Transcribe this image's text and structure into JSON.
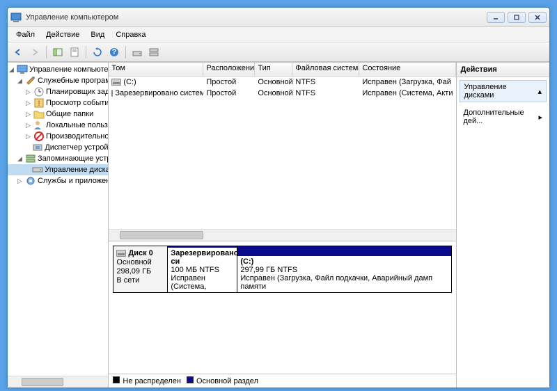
{
  "window": {
    "title": "Управление компьютером"
  },
  "menu": {
    "file": "Файл",
    "action": "Действие",
    "view": "Вид",
    "help": "Справка"
  },
  "tree": {
    "root": "Управление компьютером (л",
    "sys_tools": "Служебные программы",
    "scheduler": "Планировщик заданий",
    "eventvwr": "Просмотр событий",
    "shared": "Общие папки",
    "users": "Локальные пользоват",
    "perf": "Производительность",
    "devmgr": "Диспетчер устройств",
    "storage": "Запоминающие устройст",
    "diskmgmt": "Управление дисками",
    "services": "Службы и приложения"
  },
  "volumes": {
    "headers": {
      "vol": "Том",
      "layout": "Расположение",
      "type": "Тип",
      "fs": "Файловая система",
      "status": "Состояние"
    },
    "rows": [
      {
        "vol": "(C:)",
        "layout": "Простой",
        "type": "Основной",
        "fs": "NTFS",
        "status": "Исправен (Загрузка, Фай"
      },
      {
        "vol": "Зарезервировано системой",
        "layout": "Простой",
        "type": "Основной",
        "fs": "NTFS",
        "status": "Исправен (Система, Акти"
      }
    ]
  },
  "disk": {
    "name": "Диск 0",
    "type": "Основной",
    "size": "298,09 ГБ",
    "state": "В сети",
    "parts": [
      {
        "name": "Зарезервировано си",
        "size": "100 МБ NTFS",
        "status": "Исправен (Система,"
      },
      {
        "name": "(C:)",
        "size": "297,99 ГБ NTFS",
        "status": "Исправен (Загрузка, Файл подкачки, Аварийный дамп памяти"
      }
    ]
  },
  "legend": {
    "unalloc": "Не распределен",
    "primary": "Основной раздел"
  },
  "actions": {
    "title": "Действия",
    "group": "Управление дисками",
    "more": "Дополнительные дей..."
  }
}
